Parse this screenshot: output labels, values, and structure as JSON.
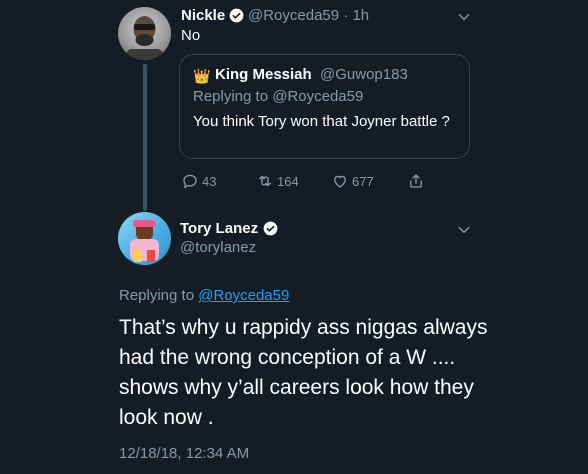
{
  "parent_tweet": {
    "author_name": "Nickle",
    "handle_time": "@Royceda59 · 1h",
    "text": "No",
    "avatar_icon": "nickle-avatar",
    "quoted": {
      "author_name": "King Messiah",
      "handle": "@Guwop183",
      "crown_icon": "👑",
      "replying_to": "Replying to @Royceda59",
      "text": "You think Tory won that Joyner battle ?"
    },
    "actions": {
      "replies": "43",
      "retweets": "164",
      "likes": "677"
    }
  },
  "main_tweet": {
    "author_name": "Tory Lanez",
    "handle": "@torylanez",
    "replying_prefix": "Replying to ",
    "replying_link": "@Royceda59",
    "text": "That’s why u rappidy ass niggas always had the wrong conception of a W .... shows why y’all careers look how they look now .",
    "timestamp": "12/18/18, 12:34 AM"
  },
  "colors": {
    "background": "#141d26",
    "secondary_text": "#8899a6",
    "link": "#1da1f2",
    "verified": "#ffffff",
    "border": "#38444d"
  }
}
